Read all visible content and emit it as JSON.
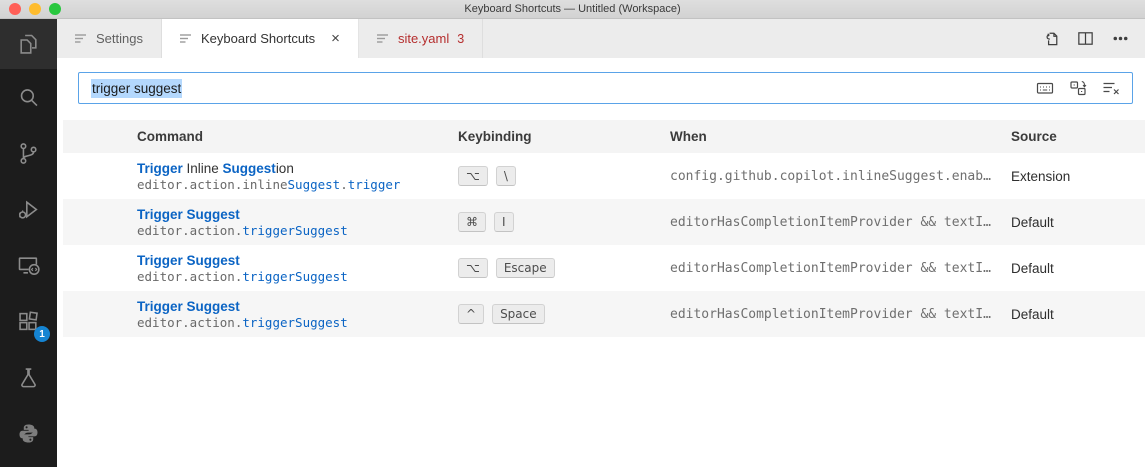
{
  "title_bar": {
    "title": "Keyboard Shortcuts — Untitled (Workspace)"
  },
  "tabs": [
    {
      "label": "Settings",
      "state": "inactive"
    },
    {
      "label": "Keyboard Shortcuts",
      "state": "active",
      "close_label": "×"
    },
    {
      "label": "site.yaml",
      "badge": "3",
      "state": "inactive-error"
    }
  ],
  "tab_actions": [
    {
      "name": "open-keyboard-shortcuts-json"
    },
    {
      "name": "split-editor"
    },
    {
      "name": "more-actions"
    }
  ],
  "search": {
    "value": "trigger suggest",
    "selected": true,
    "icons": [
      "record-keys",
      "sort-by-precedence",
      "clear-keybindings-search"
    ]
  },
  "table": {
    "headers": [
      "Command",
      "Keybinding",
      "When",
      "Source"
    ],
    "rows": [
      {
        "command_parts": [
          {
            "t": "Trigger",
            "s": "hl"
          },
          {
            "t": " Inline ",
            "s": "plain"
          },
          {
            "t": "Suggest",
            "s": "hl"
          },
          {
            "t": "ion",
            "s": "plain"
          }
        ],
        "id_parts": [
          {
            "t": "editor.action.inline",
            "s": "code"
          },
          {
            "t": "Suggest",
            "s": "code-hl"
          },
          {
            "t": ".",
            "s": "code"
          },
          {
            "t": "trigger",
            "s": "code-hl"
          }
        ],
        "keys": [
          "⌥",
          "\\"
        ],
        "when": "config.github.copilot.inlineSuggest.enab…",
        "source": "Extension"
      },
      {
        "command_parts": [
          {
            "t": "Trigger Suggest",
            "s": "hl"
          }
        ],
        "id_parts": [
          {
            "t": "editor.action.",
            "s": "code"
          },
          {
            "t": "triggerSuggest",
            "s": "code-hl"
          }
        ],
        "keys": [
          "⌘",
          "I"
        ],
        "when": "editorHasCompletionItemProvider && textI…",
        "source": "Default"
      },
      {
        "command_parts": [
          {
            "t": "Trigger Suggest",
            "s": "hl"
          }
        ],
        "id_parts": [
          {
            "t": "editor.action.",
            "s": "code"
          },
          {
            "t": "triggerSuggest",
            "s": "code-hl"
          }
        ],
        "keys": [
          "⌥",
          "Escape"
        ],
        "when": "editorHasCompletionItemProvider && textI…",
        "source": "Default"
      },
      {
        "command_parts": [
          {
            "t": "Trigger Suggest",
            "s": "hl"
          }
        ],
        "id_parts": [
          {
            "t": "editor.action.",
            "s": "code"
          },
          {
            "t": "triggerSuggest",
            "s": "code-hl"
          }
        ],
        "keys": [
          "^",
          "Space"
        ],
        "when": "editorHasCompletionItemProvider && textI…",
        "source": "Default"
      }
    ]
  },
  "activity_bar": {
    "items": [
      {
        "name": "explorer",
        "active": true
      },
      {
        "name": "search"
      },
      {
        "name": "source-control"
      },
      {
        "name": "run-and-debug"
      },
      {
        "name": "remote-explorer"
      },
      {
        "name": "extensions",
        "badge": "1"
      },
      {
        "name": "testing"
      },
      {
        "name": "python"
      }
    ]
  },
  "colors": {
    "highlight_blue": "#0b64c4",
    "code_gray": "#696969",
    "error_red": "#b52e2e",
    "badge_blue": "#1584d2",
    "selection_blue": "#b4d8fd",
    "focus_border": "#5aa3e8"
  }
}
